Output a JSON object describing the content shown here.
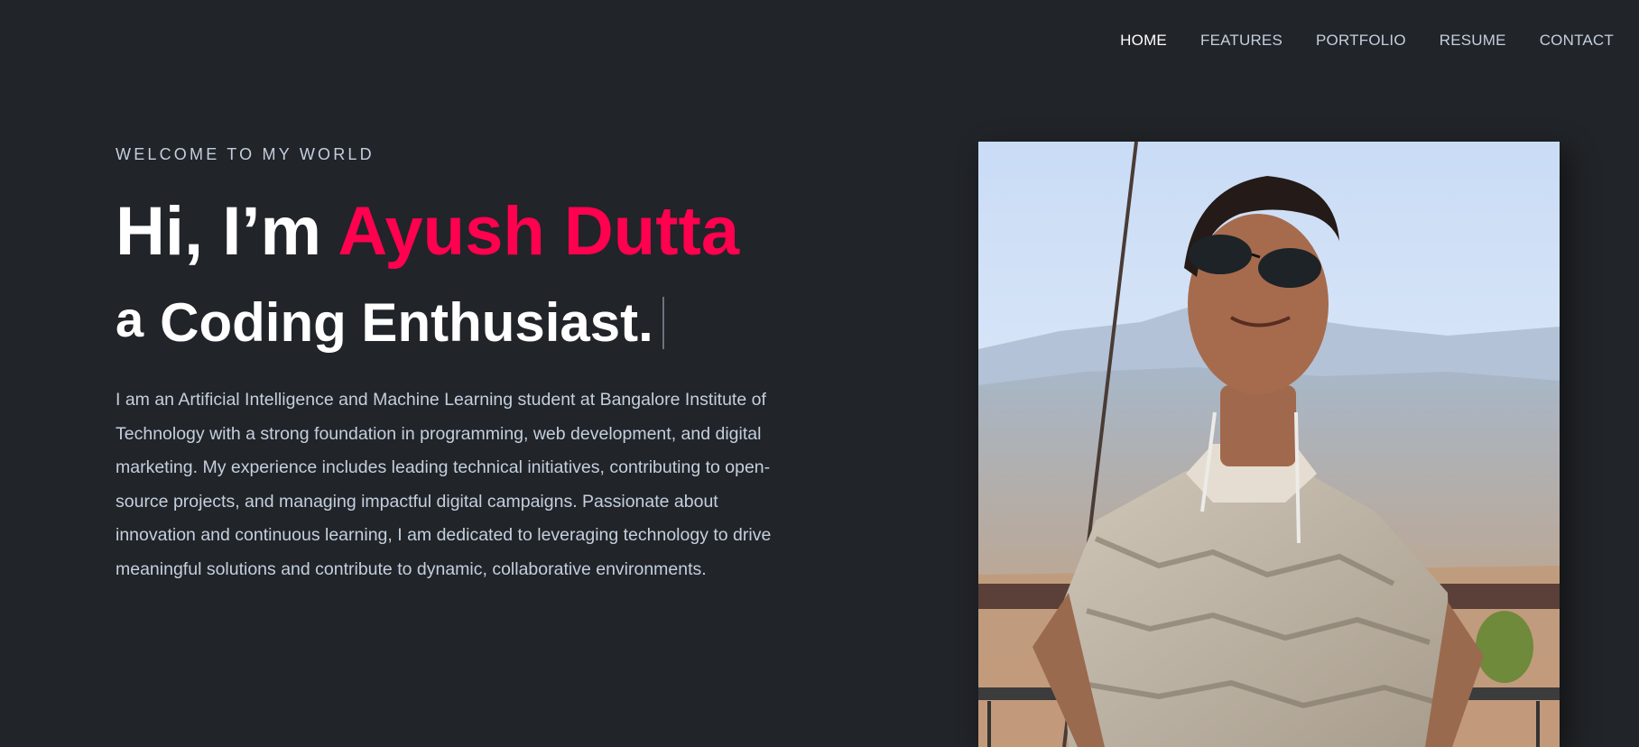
{
  "nav": {
    "items": [
      {
        "label": "HOME",
        "active": true
      },
      {
        "label": "FEATURES",
        "active": false
      },
      {
        "label": "PORTFOLIO",
        "active": false
      },
      {
        "label": "RESUME",
        "active": false
      },
      {
        "label": "CONTACT",
        "active": false
      }
    ]
  },
  "hero": {
    "eyebrow": "WELCOME TO MY WORLD",
    "greeting": "Hi, I’m ",
    "name": "Ayush Dutta",
    "role_prefix": "a",
    "role": "Coding Enthusiast.",
    "bio": "I am an Artificial Intelligence and Machine Learning student at Bangalore Institute of Technology with a strong foundation in programming, web development, and digital marketing. My experience includes leading technical initiatives, contributing to open-source projects, and managing impactful digital campaigns. Passionate about innovation and continuous learning, I am dedicated to leveraging technology to drive meaningful solutions and contribute to dynamic, collaborative environments."
  },
  "colors": {
    "background": "#212428",
    "accent": "#ff014f",
    "text": "#c4cfde",
    "heading": "#ffffff"
  },
  "photo": {
    "subject": "portrait-photo"
  }
}
